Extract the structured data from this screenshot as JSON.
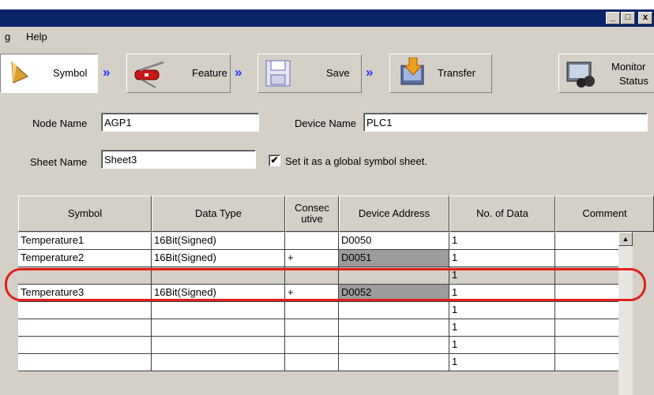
{
  "window": {
    "minimize": "_",
    "maximize": "□",
    "close": "x"
  },
  "menubar": {
    "partial": "g",
    "help": "Help"
  },
  "toolbar": {
    "symbol_label": "Symbol",
    "feature_label": "Feature",
    "save_label": "Save",
    "transfer_label": "Transfer",
    "monitor_label_1": "Monitor",
    "monitor_label_2": "Status",
    "arrow": "»"
  },
  "form": {
    "node_name_label": "Node Name",
    "node_name_value": "AGP1",
    "device_name_label": "Device Name",
    "device_name_value": "PLC1",
    "sheet_name_label": "Sheet Name",
    "sheet_name_value": "Sheet3",
    "global_checkbox_label": "Set it as a global symbol sheet.",
    "global_checkbox_checked": "✔"
  },
  "table": {
    "columns": [
      "Symbol",
      "Data Type",
      "Consec utive",
      "Device Address",
      "No. of Data",
      "Comment"
    ],
    "consec_line1": "Consec",
    "consec_line2": "utive",
    "rows": [
      [
        "Temperature1",
        "16Bit(Signed)",
        "",
        "D0050",
        "1",
        ""
      ],
      [
        "Temperature2",
        "16Bit(Signed)",
        "+",
        "D0051",
        "1",
        ""
      ],
      [
        "",
        "",
        "",
        "",
        "1",
        ""
      ],
      [
        "Temperature3",
        "16Bit(Signed)",
        "+",
        "D0052",
        "1",
        ""
      ],
      [
        "",
        "",
        "",
        "",
        "1",
        ""
      ],
      [
        "",
        "",
        "",
        "",
        "1",
        ""
      ],
      [
        "",
        "",
        "",
        "",
        "1",
        ""
      ],
      [
        "",
        "",
        "",
        "",
        "1",
        ""
      ]
    ]
  },
  "scrollbar": {
    "up_arrow": "▲"
  },
  "colors": {
    "highlight": "#e0201a",
    "titlebar": "#0a246a",
    "arrow": "#1a33ff"
  }
}
